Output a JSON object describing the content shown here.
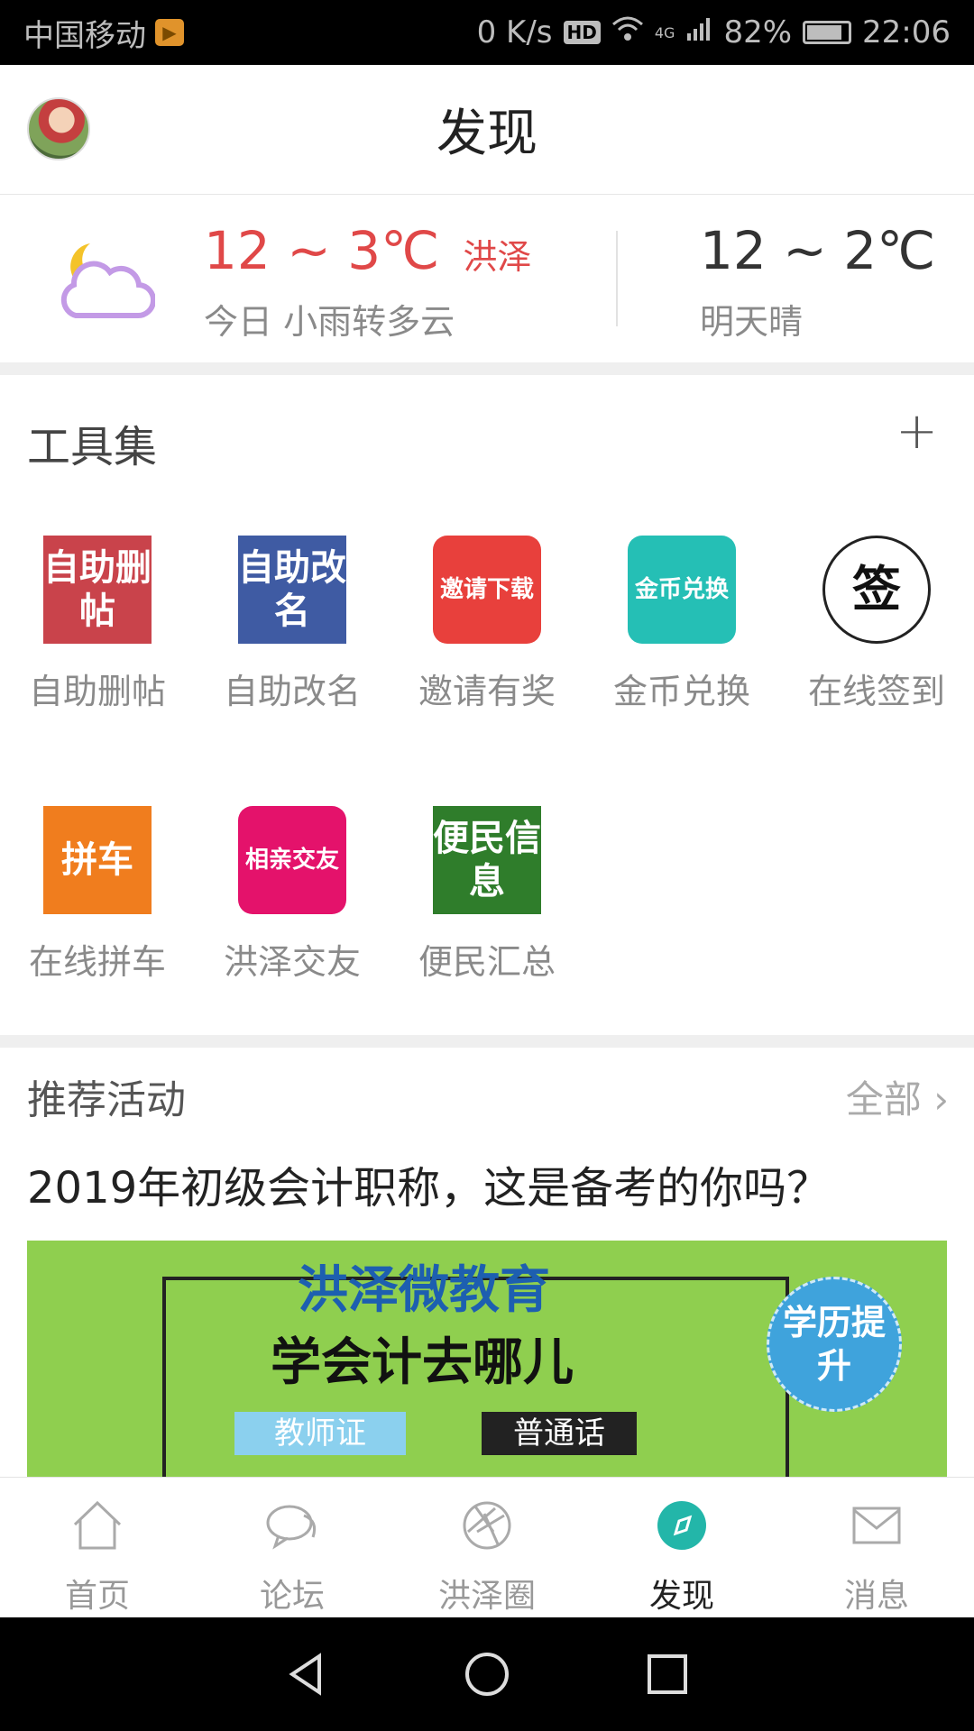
{
  "status": {
    "carrier": "中国移动",
    "speed": "0 K/s",
    "hd": "HD",
    "network": "4G",
    "battery": "82%",
    "time": "22:06"
  },
  "header": {
    "title": "发现"
  },
  "weather": {
    "today_temp": "12 ~ 3℃",
    "city": "洪泽",
    "today_desc": "今日 小雨转多云",
    "tomorrow_temp": "12 ~ 2℃",
    "tomorrow_desc": "明天晴"
  },
  "tools": {
    "title": "工具集",
    "add_icon": "+",
    "items": [
      {
        "label": "自助删帖",
        "icon_text": "自助删帖",
        "icon": "delete-post-icon",
        "color": "#c9434b"
      },
      {
        "label": "自助改名",
        "icon_text": "自助改名",
        "icon": "rename-icon",
        "color": "#3f5ba3"
      },
      {
        "label": "邀请有奖",
        "icon_text": "邀请下载",
        "icon": "invite-icon",
        "color": "#e8403c"
      },
      {
        "label": "金币兑换",
        "icon_text": "金币兑换",
        "icon": "coin-exchange-icon",
        "color": "#25bfb5"
      },
      {
        "label": "在线签到",
        "icon_text": "签",
        "icon": "sign-in-icon",
        "color": "#ffffff"
      },
      {
        "label": "在线拼车",
        "icon_text": "拼车",
        "icon": "carpool-icon",
        "color": "#f07d1e"
      },
      {
        "label": "洪泽交友",
        "icon_text": "相亲交友",
        "icon": "dating-icon",
        "color": "#e4126b"
      },
      {
        "label": "便民汇总",
        "icon_text": "便民信息",
        "icon": "info-icon",
        "color": "#2f7d2b"
      }
    ]
  },
  "activity": {
    "title": "推荐活动",
    "all_label": "全部",
    "post_title": "2019年初级会计职称，这是备考的你吗？",
    "banner": {
      "line1": "洪泽微教育",
      "line2": "学会计去哪儿",
      "tag1": "教师证",
      "tag2": "普通话",
      "badge": "学历提升"
    }
  },
  "tabs": [
    {
      "label": "首页",
      "icon": "home-icon"
    },
    {
      "label": "论坛",
      "icon": "chat-icon"
    },
    {
      "label": "洪泽圈",
      "icon": "aperture-icon"
    },
    {
      "label": "发现",
      "icon": "compass-icon",
      "active": true
    },
    {
      "label": "消息",
      "icon": "mail-icon"
    }
  ]
}
